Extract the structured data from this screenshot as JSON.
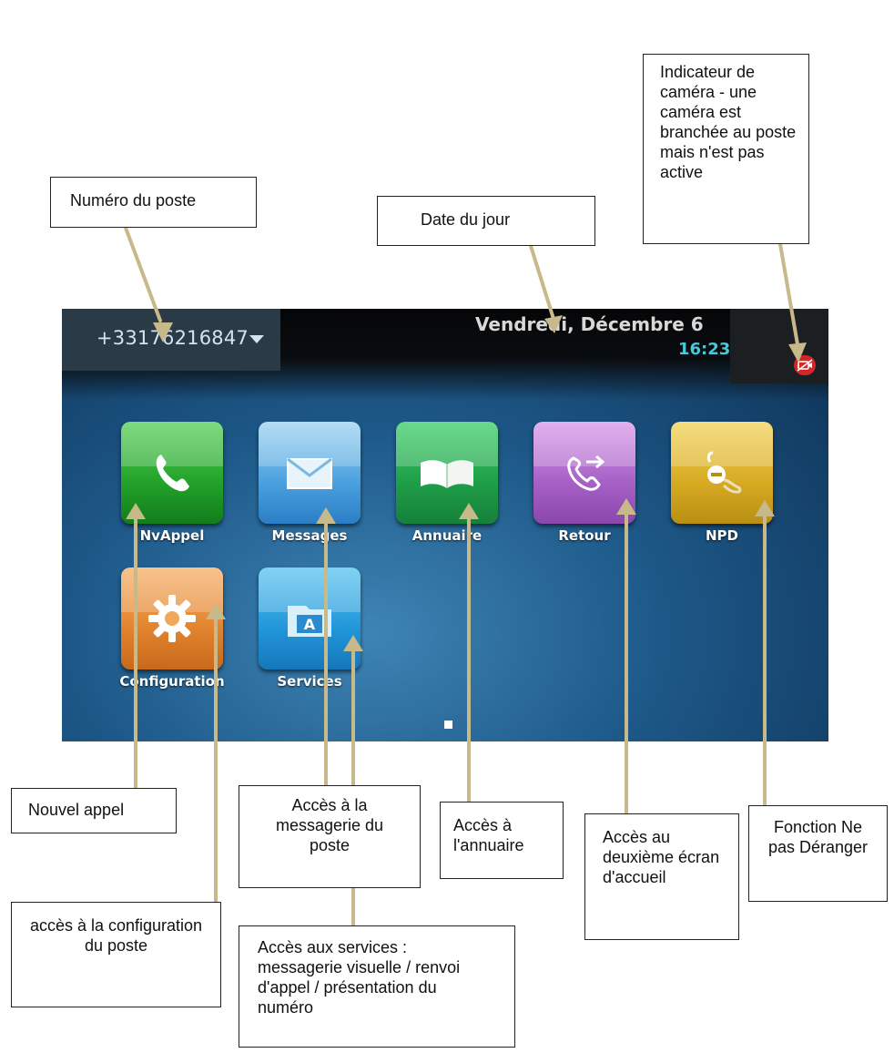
{
  "screen": {
    "line_number": "+33176216847",
    "date": "Vendredi, Décembre 6",
    "time": "16:23",
    "apps": [
      {
        "label": "NvAppel",
        "icon": "phone-icon",
        "color": "#22a22a"
      },
      {
        "label": "Messages",
        "icon": "envelope-icon",
        "color": "#4aa0df"
      },
      {
        "label": "Annuaire",
        "icon": "open-book-icon",
        "color": "#1f9e48"
      },
      {
        "label": "Retour",
        "icon": "phone-forward-icon",
        "color": "#a660c6"
      },
      {
        "label": "NPD",
        "icon": "do-not-disturb-icon",
        "color": "#d7aa22"
      },
      {
        "label": "Configuration",
        "icon": "gear-icon",
        "color": "#e2832e"
      },
      {
        "label": "Services",
        "icon": "services-folder-icon",
        "color": "#2196d9"
      }
    ]
  },
  "callouts": {
    "numero_poste": "Numéro du poste",
    "date_jour": "Date du jour",
    "indicateur_camera": "Indicateur de caméra  - une caméra est branchée au poste mais n'est pas active",
    "nouvel_appel": "Nouvel appel",
    "acces_messagerie": "Accès à la messagerie du poste",
    "acces_annuaire": "Accès  à l'annuaire",
    "acces_deuxieme_ecran": "Accès  au deuxième écran d'accueil",
    "fonction_npd": "Fonction Ne pas Déranger",
    "acces_configuration": "accès à la configuration du poste",
    "acces_services": "Accès aux services : messagerie visuelle / renvoi d'appel / présentation du numéro"
  },
  "colors": {
    "pointer": "#c8b98a",
    "time": "#48c8d8",
    "camera_indicator": "#d02828"
  }
}
